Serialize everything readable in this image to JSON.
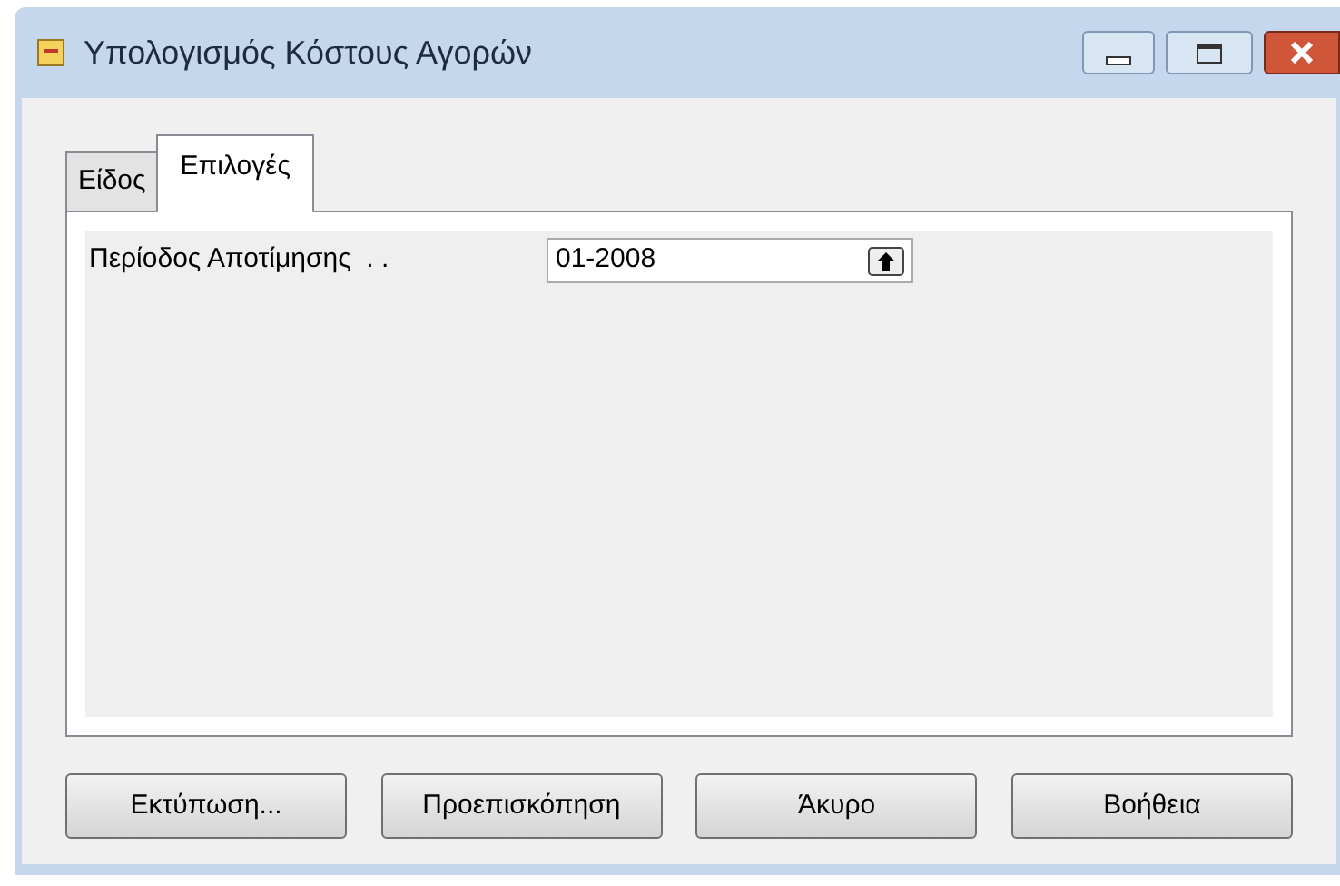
{
  "window": {
    "title": "Υπολογισμός Κόστους Αγορών"
  },
  "tabs": [
    {
      "label": "Είδος",
      "selected": false
    },
    {
      "label": "Επιλογές",
      "selected": true
    }
  ],
  "field": {
    "label": "Περίοδος Αποτίμησης  . .",
    "value": "01-2008"
  },
  "buttons": [
    "Εκτύπωση...",
    "Προεπισκόπηση",
    "Άκυρο",
    "Βοήθεια"
  ]
}
